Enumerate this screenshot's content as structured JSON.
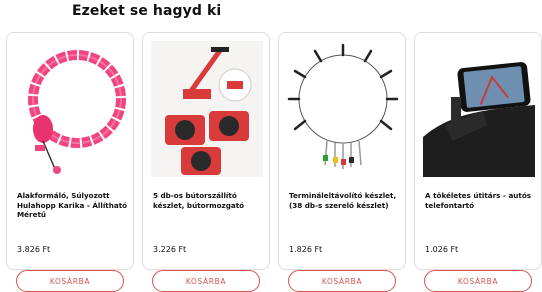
{
  "section": {
    "title": "Ezeket se hagyd ki"
  },
  "products": [
    {
      "name": "Alakformáló, Súlyozott Hulahopp Karika - Állítható Méretű",
      "price": "3.826 Ft",
      "button": "KOSÁRBA"
    },
    {
      "name": "5 db-os bútorszállító készlet, bútormozgató",
      "price": "3.226 Ft",
      "button": "KOSÁRBA"
    },
    {
      "name": "Termináleltávolító készlet, (38 db-s szerelő készlet)",
      "price": "1.826 Ft",
      "button": "KOSÁRBA"
    },
    {
      "name": "A tökéletes útitárs - autós telefontartó",
      "price": "1.026 Ft",
      "button": "KOSÁRBA"
    }
  ],
  "colors": {
    "accent": "#d9544f",
    "hoop_pink": "#f0457e",
    "mover_red": "#d93a3a"
  }
}
